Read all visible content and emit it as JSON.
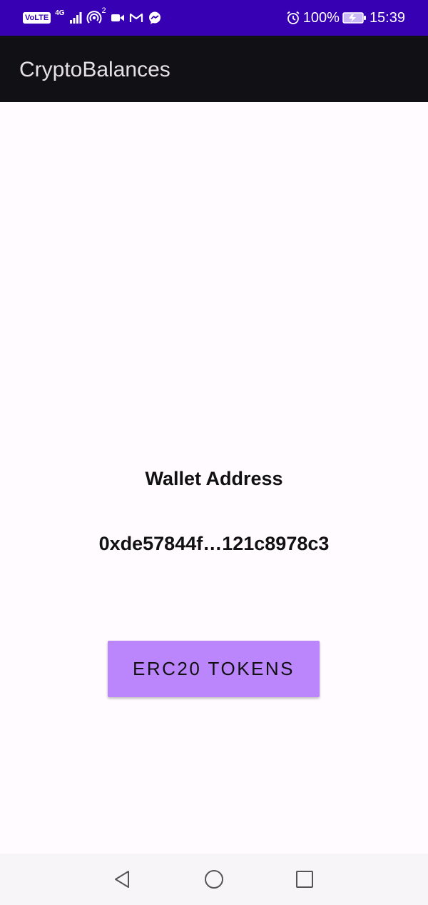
{
  "status_bar": {
    "volte_label": "VoLTE",
    "network_type": "4G",
    "hotspot_count": "2",
    "battery_percent": "100%",
    "time": "15:39",
    "icons": [
      "volte-icon",
      "signal-icon",
      "hotspot-icon",
      "video-call-icon",
      "gmail-icon",
      "messenger-icon",
      "alarm-icon",
      "battery-charging-icon"
    ],
    "background_color": "#3700b3"
  },
  "app_bar": {
    "title": "CryptoBalances",
    "background_color": "#111014"
  },
  "main": {
    "wallet_label": "Wallet Address",
    "wallet_address": "0xde57844f…121c8978c3",
    "erc20_button_label": "ERC20 TOKENS",
    "button_color": "#bb86fc"
  },
  "nav_bar": {
    "icons": [
      "back-icon",
      "home-icon",
      "recents-icon"
    ]
  }
}
